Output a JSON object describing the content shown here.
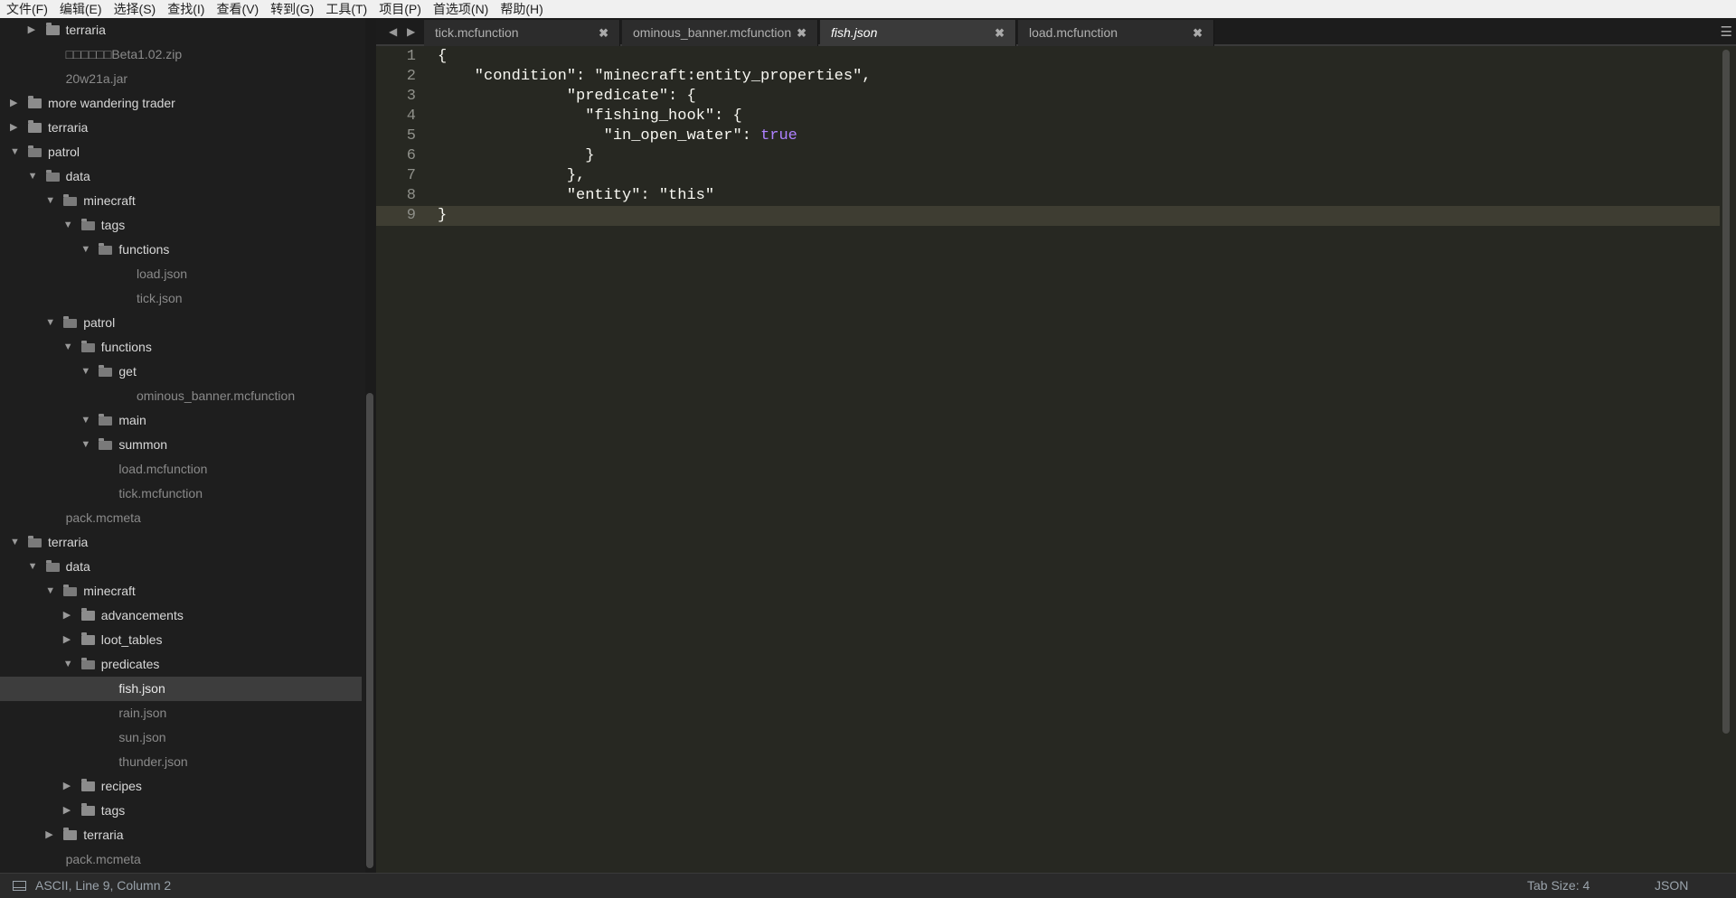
{
  "menu": [
    "文件(F)",
    "编辑(E)",
    "选择(S)",
    "查找(I)",
    "查看(V)",
    "转到(G)",
    "工具(T)",
    "项目(P)",
    "首选项(N)",
    "帮助(H)"
  ],
  "sidebar": {
    "items": [
      {
        "label": "terraria",
        "depth": 1,
        "type": "folder",
        "open": false
      },
      {
        "label": "□□□□□□Beta1.02.zip",
        "depth": 1,
        "type": "file"
      },
      {
        "label": "20w21a.jar",
        "depth": 1,
        "type": "file"
      },
      {
        "label": "more wandering trader",
        "depth": 0,
        "type": "folder",
        "open": false
      },
      {
        "label": "terraria",
        "depth": 0,
        "type": "folder",
        "open": false
      },
      {
        "label": "patrol",
        "depth": 0,
        "type": "folder",
        "open": true
      },
      {
        "label": "data",
        "depth": 1,
        "type": "folder",
        "open": true
      },
      {
        "label": "minecraft",
        "depth": 2,
        "type": "folder",
        "open": true
      },
      {
        "label": "tags",
        "depth": 3,
        "type": "folder",
        "open": true
      },
      {
        "label": "functions",
        "depth": 4,
        "type": "folder",
        "open": true
      },
      {
        "label": "load.json",
        "depth": 5,
        "type": "file"
      },
      {
        "label": "tick.json",
        "depth": 5,
        "type": "file"
      },
      {
        "label": "patrol",
        "depth": 2,
        "type": "folder",
        "open": true
      },
      {
        "label": "functions",
        "depth": 3,
        "type": "folder",
        "open": true
      },
      {
        "label": "get",
        "depth": 4,
        "type": "folder",
        "open": true
      },
      {
        "label": "ominous_banner.mcfunction",
        "depth": 5,
        "type": "file"
      },
      {
        "label": "main",
        "depth": 4,
        "type": "folder",
        "open": true
      },
      {
        "label": "summon",
        "depth": 4,
        "type": "folder",
        "open": true
      },
      {
        "label": "load.mcfunction",
        "depth": 4,
        "type": "file"
      },
      {
        "label": "tick.mcfunction",
        "depth": 4,
        "type": "file"
      },
      {
        "label": "pack.mcmeta",
        "depth": 1,
        "type": "file"
      },
      {
        "label": "terraria",
        "depth": 0,
        "type": "folder",
        "open": true
      },
      {
        "label": "data",
        "depth": 1,
        "type": "folder",
        "open": true
      },
      {
        "label": "minecraft",
        "depth": 2,
        "type": "folder",
        "open": true
      },
      {
        "label": "advancements",
        "depth": 3,
        "type": "folder",
        "open": false
      },
      {
        "label": "loot_tables",
        "depth": 3,
        "type": "folder",
        "open": false
      },
      {
        "label": "predicates",
        "depth": 3,
        "type": "folder",
        "open": true
      },
      {
        "label": "fish.json",
        "depth": 4,
        "type": "file",
        "selected": true
      },
      {
        "label": "rain.json",
        "depth": 4,
        "type": "file"
      },
      {
        "label": "sun.json",
        "depth": 4,
        "type": "file"
      },
      {
        "label": "thunder.json",
        "depth": 4,
        "type": "file"
      },
      {
        "label": "recipes",
        "depth": 3,
        "type": "folder",
        "open": false
      },
      {
        "label": "tags",
        "depth": 3,
        "type": "folder",
        "open": false
      },
      {
        "label": "terraria",
        "depth": 2,
        "type": "folder",
        "open": false
      },
      {
        "label": "pack.mcmeta",
        "depth": 1,
        "type": "file"
      }
    ]
  },
  "tabs": [
    {
      "label": "tick.mcfunction",
      "active": false
    },
    {
      "label": "ominous_banner.mcfunction",
      "active": false
    },
    {
      "label": "fish.json",
      "active": true
    },
    {
      "label": "load.mcfunction",
      "active": false
    }
  ],
  "tab_close_glyph": "✖",
  "editor": {
    "current_line": 9,
    "lines": [
      {
        "n": "1",
        "text": "{"
      },
      {
        "n": "2",
        "text": "    \"condition\": \"minecraft:entity_properties\","
      },
      {
        "n": "3",
        "text": "              \"predicate\": {"
      },
      {
        "n": "4",
        "text": "                \"fishing_hook\": {"
      },
      {
        "n": "5",
        "text": "                  \"in_open_water\": ",
        "kw": "true"
      },
      {
        "n": "6",
        "text": "                }"
      },
      {
        "n": "7",
        "text": "              },"
      },
      {
        "n": "8",
        "text": "              \"entity\": \"this\""
      },
      {
        "n": "9",
        "text": "}"
      }
    ]
  },
  "status": {
    "position": "ASCII, Line 9, Column 2",
    "tab_size": "Tab Size: 4",
    "syntax": "JSON"
  },
  "colors": {
    "editor_bg": "#272822",
    "sidebar_bg": "#1e1e1e",
    "keyword": "#ae81ff",
    "text": "#f8f8f2"
  }
}
